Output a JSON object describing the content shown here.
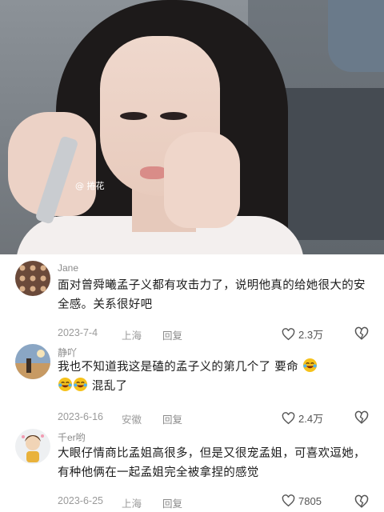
{
  "hero": {
    "watermark": "@ 捲花"
  },
  "comments": [
    {
      "username": "Jane",
      "text": "面对曾舜曦孟子义都有攻击力了，说明他真的给她很大的安全感。关系很好吧",
      "date": "2023-7-4",
      "location": "上海",
      "reply_label": "回复",
      "likes": "2.3万",
      "avatar": "avatar-jane"
    },
    {
      "username": "静吖",
      "text_line1": "我也不知道我这是磕的孟子义的第几个了 要命",
      "text_line2": "混乱了",
      "date": "2023-6-16",
      "location": "安徽",
      "reply_label": "回复",
      "likes": "2.4万",
      "emoji": "laughing-crying-emoji",
      "avatar": "avatar-jingya"
    },
    {
      "username": "千er哟",
      "text": "大眼仔情商比孟姐高很多，但是又很宠孟姐，可喜欢逗她，有种他俩在一起孟姐完全被拿捏的感觉",
      "date": "2023-6-25",
      "location": "上海",
      "reply_label": "回复",
      "likes": "7805",
      "avatar": "avatar-qianer"
    }
  ],
  "colors": {
    "meta_text": "#9a9a9a",
    "body_text": "#1c1c1c",
    "emoji_face": "#f6c21b"
  }
}
